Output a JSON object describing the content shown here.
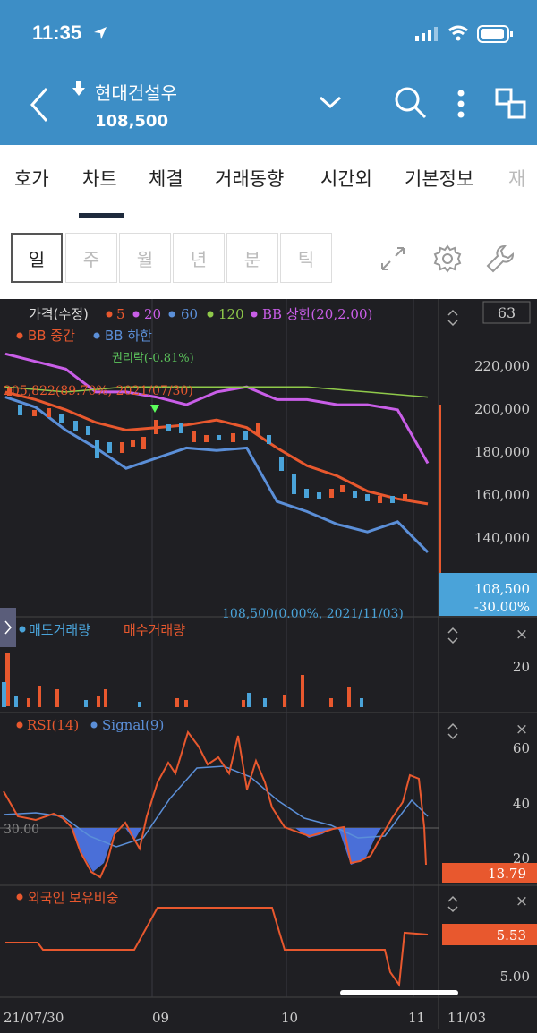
{
  "status": {
    "time": "11:35"
  },
  "header": {
    "stock_name": "현대건설우",
    "price": "108,500"
  },
  "tabs": [
    "호가",
    "차트",
    "체결",
    "거래동향",
    "시간외",
    "기본정보",
    "재"
  ],
  "periods": [
    "일",
    "주",
    "월",
    "년",
    "분",
    "틱"
  ],
  "price_panel": {
    "title": "가격(수정)",
    "legend": [
      {
        "label": "5",
        "color": "#e8582e"
      },
      {
        "label": "20",
        "color": "#c95ee8"
      },
      {
        "label": "60",
        "color": "#5b8fd8"
      },
      {
        "label": "120",
        "color": "#8fc94a"
      },
      {
        "label": "BB 상한(20,2.00)",
        "color": "#c95ee8"
      },
      {
        "label": "BB 중간",
        "color": "#e8582e"
      },
      {
        "label": "BB 하한",
        "color": "#5b8fd8"
      }
    ],
    "count": "63",
    "axis": [
      "220,000",
      "200,000",
      "180,000",
      "160,000",
      "140,000"
    ],
    "ex_rights": "권리락(-0.81%)",
    "high_note": "205,822(89.70%, 2021/07/30)",
    "low_note": "108,500(0.00%, 2021/11/03)",
    "current_price": "108,500",
    "current_change": "-30.00%"
  },
  "volume_panel": {
    "sell_label": "매도거래량",
    "buy_label": "매수거래량",
    "axis": "20"
  },
  "rsi_panel": {
    "label1": "RSI(14)",
    "label2": "Signal(9)",
    "axis": [
      "60",
      "40",
      "20"
    ],
    "level": "30.00",
    "value": "13.79"
  },
  "foreign_panel": {
    "label": "외국인 보유비중",
    "axis": "5.00",
    "value": "5.53"
  },
  "xaxis": [
    "21/07/30",
    "09",
    "10",
    "11",
    "11/03"
  ],
  "chart_data": {
    "type": "line",
    "x_labels": [
      "21/07/30",
      "09",
      "10",
      "11",
      "11/03"
    ],
    "series": [
      {
        "name": "BB 상한(20,2.00)",
        "values": [
          214000,
          211000,
          208000,
          199000,
          199000,
          197000,
          194000,
          199000,
          201000,
          196000,
          196000,
          194000,
          194000,
          192000,
          171000
        ]
      },
      {
        "name": "BB 중간",
        "values": [
          199000,
          196000,
          192000,
          187000,
          184000,
          185000,
          186000,
          188000,
          185000,
          177000,
          170000,
          166000,
          160000,
          157000,
          155000
        ]
      },
      {
        "name": "BB 하한",
        "values": [
          197000,
          193000,
          184000,
          177000,
          169000,
          173000,
          177000,
          176000,
          177000,
          156000,
          152000,
          147000,
          144000,
          148000,
          136000
        ]
      },
      {
        "name": "120",
        "values": [
          201000,
          200000,
          199000,
          200000,
          201000,
          201000,
          201000,
          201000,
          201000,
          201000,
          201000,
          200000,
          199000,
          198000,
          197000
        ]
      }
    ],
    "ylim": [
      130000,
      225000
    ]
  }
}
